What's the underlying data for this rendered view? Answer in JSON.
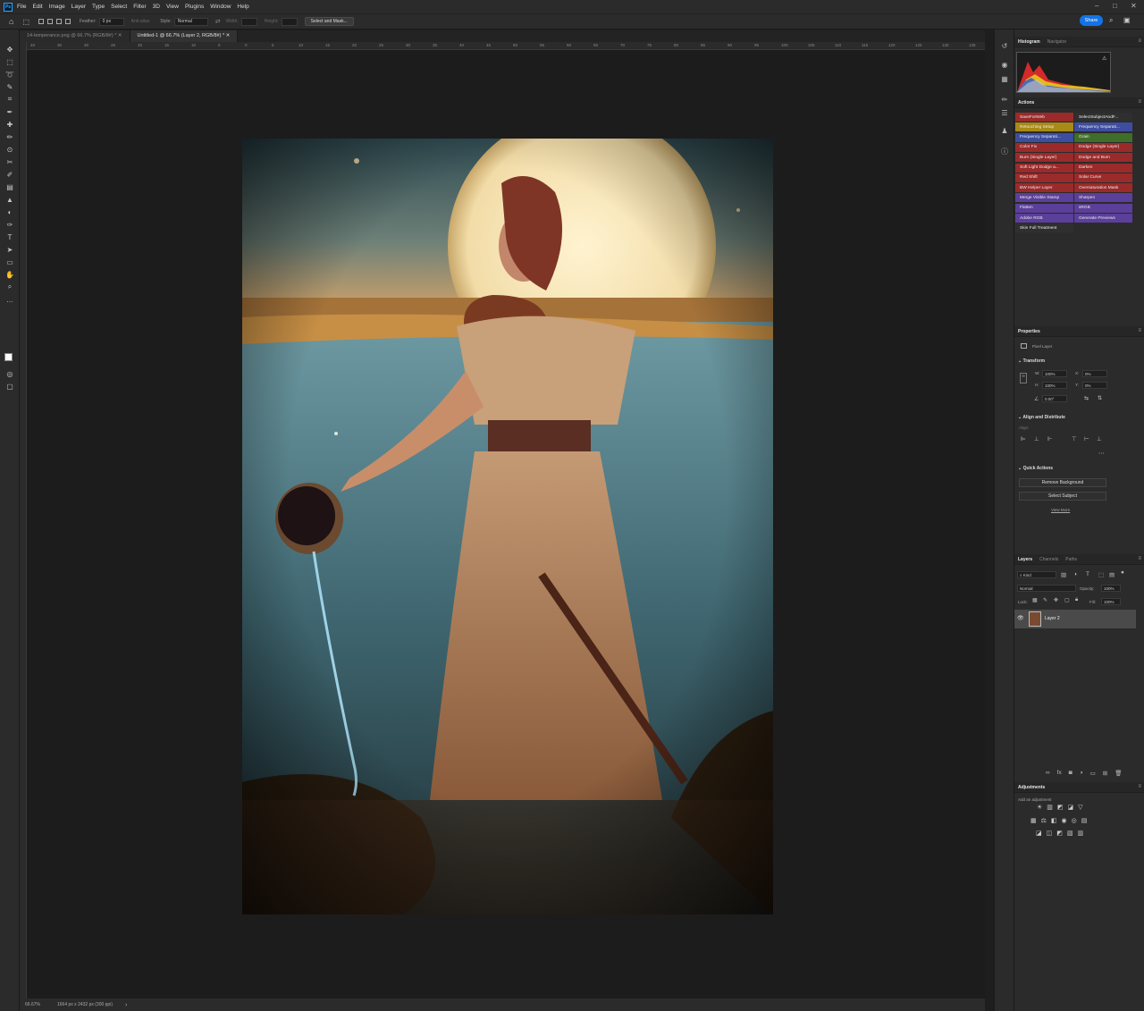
{
  "menubar": {
    "app_icon": "Ps",
    "items": [
      "File",
      "Edit",
      "Image",
      "Layer",
      "Type",
      "Select",
      "Filter",
      "3D",
      "View",
      "Plugins",
      "Window",
      "Help"
    ],
    "window_controls": [
      "minimize-icon",
      "maximize-icon",
      "close-icon"
    ]
  },
  "options": {
    "feather_label": "Feather:",
    "feather_value": "0 px",
    "antialias_label": "Anti-alias",
    "style_label": "Style:",
    "style_value": "Normal",
    "width_label": "Width:",
    "height_label": "Height:",
    "select_mask_label": "Select and Mask...",
    "share_label": "Share"
  },
  "tabs": [
    {
      "label": "14-temperance.png @ 66.7% (RGB/8#) *",
      "active": false
    },
    {
      "label": "Untitled-1 @ 66.7% (Layer 2, RGB/8#) *",
      "active": true
    }
  ],
  "ruler": {
    "marks": [
      "40",
      "35",
      "30",
      "25",
      "20",
      "15",
      "10",
      "5",
      "0",
      "5",
      "10",
      "15",
      "20",
      "25",
      "30",
      "35",
      "40",
      "45",
      "50",
      "55",
      "60",
      "65",
      "70",
      "75",
      "80",
      "85",
      "90",
      "95",
      "100",
      "105",
      "110",
      "115",
      "120",
      "125",
      "130",
      "135",
      "140"
    ]
  },
  "status": {
    "zoom": "66.67%",
    "doc_info": "1664 px x 2432 px (300 ppi)"
  },
  "histogram_panel": {
    "tabs": [
      "Histogram",
      "Navigator"
    ],
    "warning": "⚠"
  },
  "actions_panel": {
    "title": "Actions",
    "left": [
      {
        "label": "SaveForWeb",
        "color": "#9b2a2a"
      },
      {
        "label": "Retouching Setup",
        "color": "#a88a16"
      },
      {
        "label": "Frequency Separati...",
        "color": "#3d4ea0"
      },
      {
        "label": "Color Fix",
        "color": "#9b2a2a"
      },
      {
        "label": "Burn (Single Layer)",
        "color": "#9b2a2a"
      },
      {
        "label": "Soft Light Dodge a...",
        "color": "#9b2a2a"
      },
      {
        "label": "Red Shift",
        "color": "#9b2a2a"
      },
      {
        "label": "BW Helper Layer",
        "color": "#9b2a2a"
      },
      {
        "label": "Merge Visible Stamp",
        "color": "#5b3f9a"
      },
      {
        "label": "Flatten",
        "color": "#5b3f9a"
      },
      {
        "label": "Adobe RGB",
        "color": "#5b3f9a"
      },
      {
        "label": "Skin Full Treatment",
        "color": "#2f2f2f"
      }
    ],
    "right": [
      {
        "label": "SelectSubjectAndF...",
        "color": "#2f2f2f"
      },
      {
        "label": "Frequency Separati...",
        "color": "#3d4ea0"
      },
      {
        "label": "Grain",
        "color": "#3f6e2a"
      },
      {
        "label": "Dodge (Single Layer)",
        "color": "#9b2a2a"
      },
      {
        "label": "Dodge and Burn",
        "color": "#9b2a2a"
      },
      {
        "label": "Darken",
        "color": "#9b2a2a"
      },
      {
        "label": "Solar Curve",
        "color": "#9b2a2a"
      },
      {
        "label": "Oversaturation Mask",
        "color": "#9b2a2a"
      },
      {
        "label": "Sharpen",
        "color": "#5b3f9a"
      },
      {
        "label": "sRGB",
        "color": "#5b3f9a"
      },
      {
        "label": "Generate Previews",
        "color": "#5b3f9a"
      }
    ]
  },
  "properties_panel": {
    "title": "Properties",
    "layer_type": "Pixel Layer",
    "transform_title": "Transform",
    "w_label": "W:",
    "w_value": "100%",
    "h_label": "H:",
    "h_value": "100%",
    "x_label": "X:",
    "x_value": "0%",
    "y_label": "Y:",
    "y_value": "0%",
    "angle_value": "0.00°",
    "align_title": "Align and Distribute",
    "align_label": "Align:",
    "quick_title": "Quick Actions",
    "remove_bg": "Remove Background",
    "select_subject": "Select Subject",
    "view_more": "View More"
  },
  "layers_panel": {
    "tabs": [
      "Layers",
      "Channels",
      "Paths"
    ],
    "kind_label": "Kind",
    "blend_mode": "Normal",
    "opacity_label": "Opacity:",
    "opacity_value": "100%",
    "lock_label": "Lock:",
    "fill_label": "Fill:",
    "fill_value": "100%",
    "layers": [
      {
        "name": "Layer 2",
        "visible": true
      }
    ]
  },
  "adjustments_panel": {
    "title": "Adjustments",
    "hint": "Add an adjustment"
  }
}
